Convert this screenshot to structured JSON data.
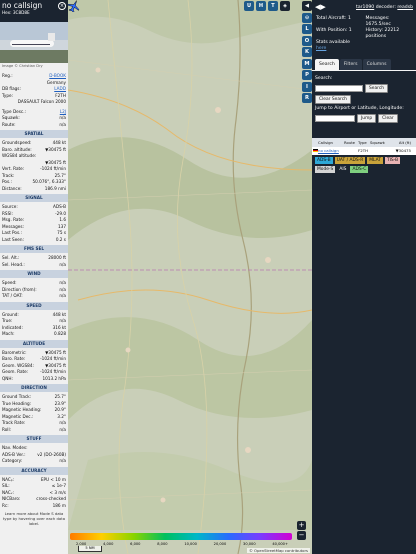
{
  "info": {
    "callsign": "no callsign",
    "hex_label": "Hex:",
    "hex": "3C8D8E",
    "image_credit": "Image © Christian Dry",
    "reg_label": "Reg.:",
    "reg": "D-BOOK",
    "country": "Germany",
    "db_flags_label": "DB flags:",
    "db_flags": "LADD",
    "type_label": "Type:",
    "type": "F2TH",
    "type_full": "DASSAULT Falcon 2000",
    "type_desc_label": "Type Desc.:",
    "type_desc": "L2J",
    "squawk_label": "Squawk:",
    "squawk": "n/a",
    "route_label": "Route:",
    "route": "n/a",
    "sections": {
      "spatial": "SPATIAL",
      "signal": "SIGNAL",
      "fms": "FMS SEL",
      "wind": "WIND",
      "speed": "SPEED",
      "altitude": "ALTITUDE",
      "direction": "DIRECTION",
      "stuff": "STUFF",
      "accuracy": "ACCURACY"
    },
    "spatial": [
      {
        "k": "Groundspeed:",
        "v": "448 kt"
      },
      {
        "k": "Baro. altitude:",
        "v": "▼30475 ft"
      },
      {
        "k": "WGS84 altitude:",
        "v": ""
      },
      {
        "k": "",
        "v": "▼30475 ft"
      },
      {
        "k": "Vert. Rate:",
        "v": "-1024 ft/min"
      },
      {
        "k": "Track:",
        "v": "25.7°"
      },
      {
        "k": "Pos.:",
        "v": "50.076°, 6.333°"
      },
      {
        "k": "Distance:",
        "v": "186.9 nmi"
      }
    ],
    "signal": [
      {
        "k": "Source:",
        "v": "ADS-B"
      },
      {
        "k": "RSSI:",
        "v": "-29.0"
      },
      {
        "k": "Msg. Rate:",
        "v": "1.6"
      },
      {
        "k": "Messages:",
        "v": "137"
      },
      {
        "k": "Last Pos.:",
        "v": "75 s"
      },
      {
        "k": "Last Seen:",
        "v": "0.2 s"
      }
    ],
    "fms": [
      {
        "k": "Sel. Alt.:",
        "v": "28000 ft"
      },
      {
        "k": "Sel. Head.:",
        "v": "n/a"
      }
    ],
    "wind": [
      {
        "k": "Speed:",
        "v": "n/a"
      },
      {
        "k": "Direction (from):",
        "v": "n/a"
      },
      {
        "k": "TAT / OAT:",
        "v": "n/a"
      }
    ],
    "speed": [
      {
        "k": "Ground:",
        "v": "448 kt"
      },
      {
        "k": "True:",
        "v": "n/a"
      },
      {
        "k": "Indicated:",
        "v": "316 kt"
      },
      {
        "k": "Mach:",
        "v": "0.828"
      }
    ],
    "altitude": [
      {
        "k": "Barometric:",
        "v": "▼30475 ft"
      },
      {
        "k": "Baro. Rate:",
        "v": "-1024 ft/min"
      },
      {
        "k": "Geom. WGS84:",
        "v": "▼30475 ft"
      },
      {
        "k": "Geom. Rate:",
        "v": "-1024 ft/min"
      },
      {
        "k": "QNH:",
        "v": "1013.2 hPa"
      }
    ],
    "direction": [
      {
        "k": "Ground Track:",
        "v": "25.7°"
      },
      {
        "k": "True Heading:",
        "v": "23.9°"
      },
      {
        "k": "Magnetic Heading:",
        "v": "20.9°"
      },
      {
        "k": "Magnetic Dec.:",
        "v": "3.2°"
      },
      {
        "k": "Track Rate:",
        "v": "n/a"
      },
      {
        "k": "Roll:",
        "v": "n/a"
      }
    ],
    "stuff": [
      {
        "k": "Nav. Modes:",
        "v": ""
      },
      {
        "k": "ADS-B Ver.:",
        "v": "v2 (DO-260B)"
      },
      {
        "k": "Category:",
        "v": "n/a"
      }
    ],
    "accuracy": [
      {
        "k": "NACₚ:",
        "v": "EPU < 10 m"
      },
      {
        "k": "SIL:",
        "v": "≤ 1e-7"
      },
      {
        "k": "NACᵥ:",
        "v": "< 3 m/s"
      },
      {
        "k": "NICBaro:",
        "v": "cross-checked"
      },
      {
        "k": "Rc:",
        "v": "186 m"
      }
    ],
    "footer": "Learn more about Mode S data type by hovering over each data label."
  },
  "map": {
    "top_buttons": [
      "U",
      "H",
      "T"
    ],
    "scale": "5 NM",
    "legend_labels": [
      "2,000",
      "4,000",
      "6,000",
      "8,000",
      "10,000",
      "20,000",
      "30,000",
      "40,000+"
    ],
    "attribution": "© OpenStreetMap contributors",
    "zoom_in": "+",
    "zoom_out": "−"
  },
  "strip_buttons": [
    "◀",
    "⊙",
    "L",
    "O",
    "K",
    "M",
    "P",
    "I",
    "R"
  ],
  "sidebar": {
    "arrows": "◀▶",
    "version_link": "tar1090",
    "version_suffix": "decoder:",
    "decoder": "readsb",
    "total_aircraft_label": "Total Aircraft:",
    "total_aircraft": "1",
    "messages_label": "Messages:",
    "messages": "1675.5/sec",
    "with_position_label": "With Position:",
    "with_position": "1",
    "history_label": "History:",
    "history": "22212 positions",
    "stats_available": "Stats available",
    "stats_link": "here",
    "tabs": [
      "Search",
      "Filters",
      "Columns"
    ],
    "search_label": "Search:",
    "search_button": "Search",
    "clear_search": "Clear Search",
    "jump_label": "Jump to Airport or Latitude, Longitude:",
    "jump_button": "Jump",
    "clear_button": "Clear",
    "columns": [
      "",
      "Callsign",
      "Route",
      "Type",
      "Squawk",
      "Alt (ft)"
    ],
    "rows": [
      {
        "callsign": "no callsign",
        "route": "",
        "type": "F2TH",
        "squawk": "",
        "alt": "▼30475"
      }
    ],
    "sources": [
      {
        "label": "ADS-B",
        "color": "#2ea8d6"
      },
      {
        "label": "UAT / ADS-R",
        "color": "#c9a33a"
      },
      {
        "label": "MLAT",
        "color": "#c9a33a"
      },
      {
        "label": "TIS-B",
        "color": "#e8b3b3"
      },
      {
        "label": "Mode-S",
        "color": "#d4d4d4"
      },
      {
        "label": "AIS",
        "color": "#1b2430"
      },
      {
        "label": "ADS-C",
        "color": "#7fd07f"
      }
    ]
  }
}
